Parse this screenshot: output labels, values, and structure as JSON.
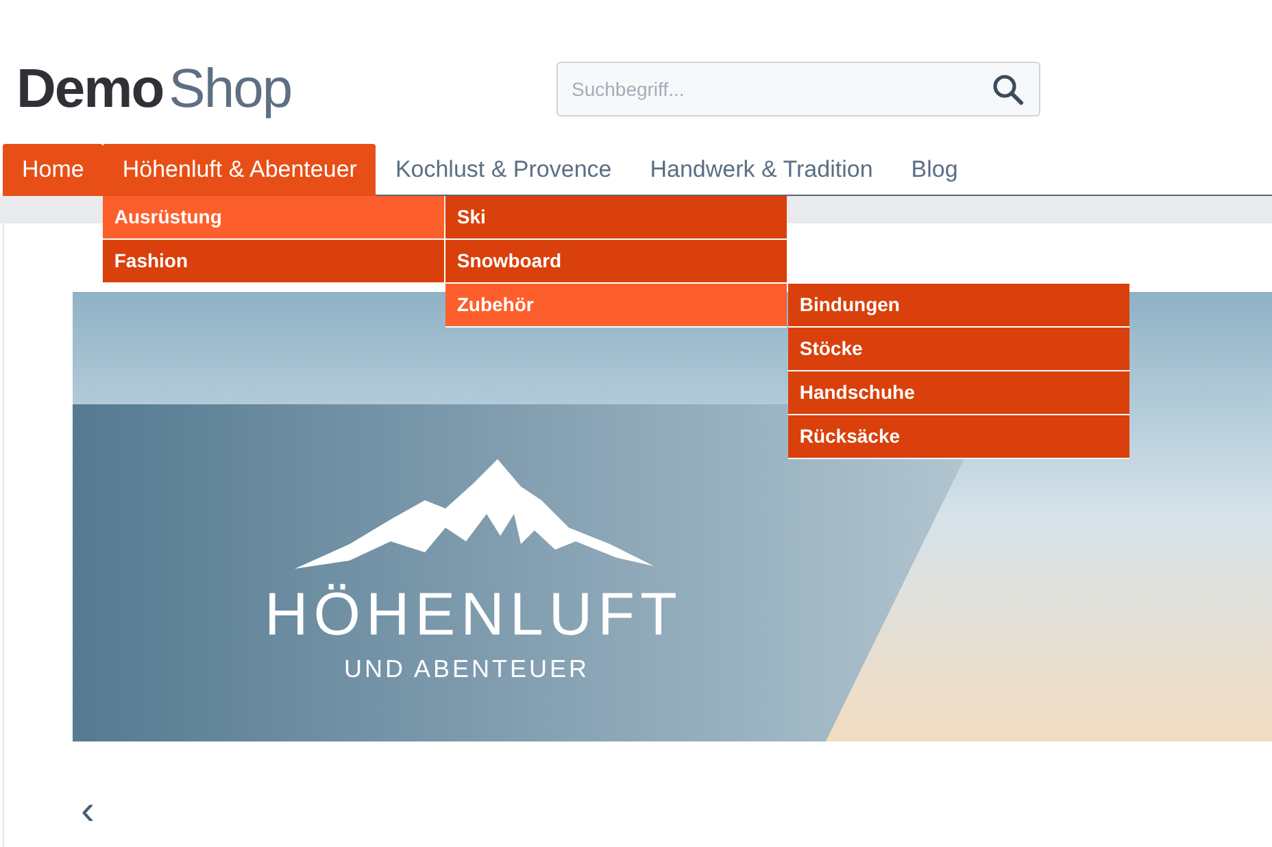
{
  "logo": {
    "bold": "Demo",
    "light": "Shop"
  },
  "search": {
    "placeholder": "Suchbegriff..."
  },
  "nav": [
    {
      "label": "Home",
      "highlighted": true
    },
    {
      "label": "Höhenluft & Abenteuer",
      "highlighted": true,
      "children": [
        {
          "label": "Ausrüstung",
          "selected": true,
          "children": [
            {
              "label": "Ski",
              "selected": false
            },
            {
              "label": "Snowboard",
              "selected": false
            },
            {
              "label": "Zubehör",
              "selected": true,
              "children": [
                {
                  "label": "Bindungen",
                  "selected": false
                },
                {
                  "label": "Stöcke",
                  "selected": false
                },
                {
                  "label": "Handschuhe",
                  "selected": false
                },
                {
                  "label": "Rücksäcke",
                  "selected": false
                }
              ]
            }
          ]
        },
        {
          "label": "Fashion",
          "selected": false
        }
      ]
    },
    {
      "label": "Kochlust & Provence",
      "highlighted": false
    },
    {
      "label": "Handwerk & Tradition",
      "highlighted": false
    },
    {
      "label": "Blog",
      "highlighted": false
    }
  ],
  "banner": {
    "title": "HÖHENLUFT",
    "subtitle": "UND ABENTEUER"
  },
  "slider": {
    "prev": "‹"
  }
}
